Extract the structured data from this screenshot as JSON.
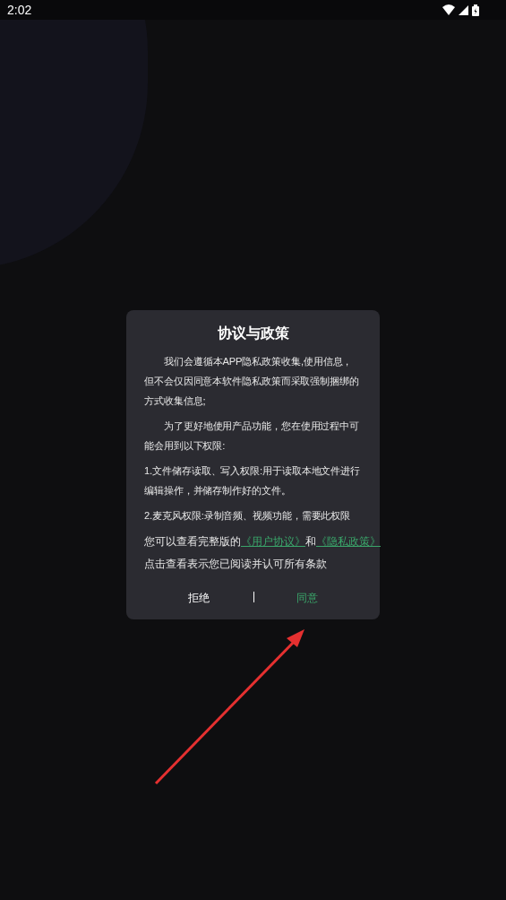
{
  "status_bar": {
    "time": "2:02"
  },
  "dialog": {
    "title": "协议与政策",
    "paragraphs": [
      "我们会遵循本APP隐私政策收集,使用信息，但不会仅因同意本软件隐私政策而采取强制捆绑的方式收集信息;",
      "为了更好地使用产品功能，您在使用过程中可能会用到以下权限:",
      "1.文件储存读取、写入权限:用于读取本地文件进行编辑操作，并储存制作好的文件。",
      "2.麦克风权限:录制音频、视频功能，需要此权限"
    ],
    "links_line": {
      "prefix": "您可以查看完整版的",
      "link_1": "《用户协议》",
      "joiner": "和",
      "link_2": "《隐私政策》"
    },
    "note": "点击查看表示您已阅读并认可所有条款",
    "buttons": [
      {
        "label": "拒绝",
        "kind": "decline"
      },
      {
        "label": "同意",
        "kind": "accept"
      }
    ]
  }
}
